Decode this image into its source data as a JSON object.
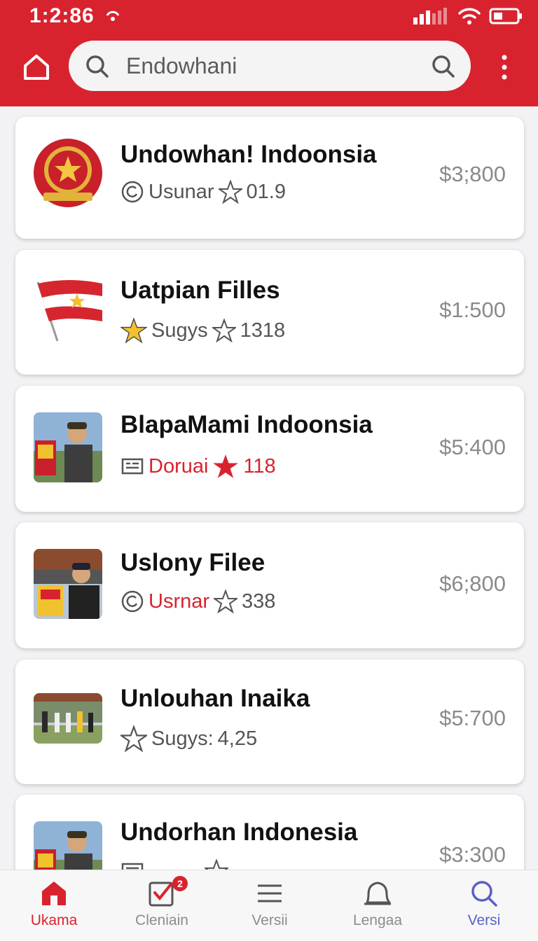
{
  "status_bar": {
    "time": "1:2:86"
  },
  "search": {
    "value": "Endowhani"
  },
  "colors": {
    "accent": "#d8232f",
    "star_gold": "#f2c12e",
    "active_blue": "#5b5fc7"
  },
  "items": [
    {
      "title": "Undowhan! Indoonsia",
      "meta_icon": "refresh-circle-icon",
      "meta_label": "Usunar",
      "star_icon": "star-outline-icon",
      "rating": "01.9",
      "price": "$3;800",
      "thumb": "emblem"
    },
    {
      "title": "Uatpian Filles",
      "meta_icon": "star-filled-gold-icon",
      "meta_label": "Sugys",
      "star_icon": "star-outline-icon",
      "rating": "1318",
      "price": "$1:500",
      "thumb": "flag"
    },
    {
      "title": "BlapaMami Indoonsia",
      "meta_icon": "document-icon",
      "meta_label": "Doruai",
      "star_icon": "star-filled-red-icon",
      "rating": "118",
      "price": "$5:400",
      "thumb": "photo-man-cap"
    },
    {
      "title": "Uslony Filee",
      "meta_icon": "refresh-circle-icon",
      "meta_label": "Usrnar",
      "star_icon": "star-outline-icon",
      "rating": "338",
      "price": "$6;800",
      "thumb": "photo-man-poster"
    },
    {
      "title": "Unlouhan Inaika",
      "meta_icon": "star-outline-icon",
      "meta_label": "Sugys:",
      "star_icon": "",
      "rating": "4,25",
      "price": "$5:700",
      "thumb": "photo-group"
    },
    {
      "title": "Undorhan Indonesia",
      "meta_icon": "document-icon",
      "meta_label": "",
      "star_icon": "star-outline-icon",
      "rating": "",
      "price": "$3:300",
      "thumb": "photo-man-cap"
    }
  ],
  "nav": [
    {
      "label": "Ukama",
      "icon": "home-filled-icon",
      "active": true
    },
    {
      "label": "Cleniain",
      "icon": "checkbox-icon",
      "badge": "2"
    },
    {
      "label": "Versii",
      "icon": "menu-lines-icon"
    },
    {
      "label": "Lengaa",
      "icon": "bell-icon"
    },
    {
      "label": "Versi",
      "icon": "search-icon"
    }
  ]
}
